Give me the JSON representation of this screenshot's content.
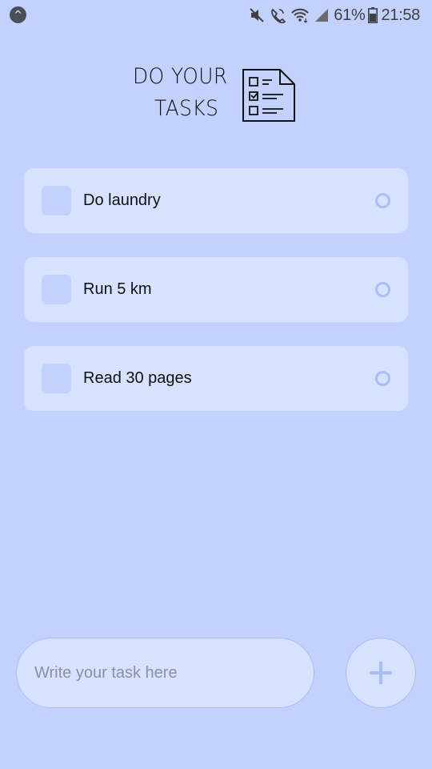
{
  "status_bar": {
    "app_badge_glyph": "^",
    "battery_percent": "61%",
    "time": "21:58",
    "icons": [
      "mute-icon",
      "call-icon",
      "wifi-icon",
      "signal-icon",
      "battery-icon"
    ]
  },
  "header": {
    "title_line1": "DO YOUR",
    "title_line2": "TASKS",
    "logo_icon": "checklist-icon"
  },
  "tasks": [
    {
      "label": "Do laundry",
      "done": false
    },
    {
      "label": "Run 5 km",
      "done": false
    },
    {
      "label": "Read 30 pages",
      "done": false
    }
  ],
  "composer": {
    "placeholder": "Write your task here",
    "value": "",
    "add_icon": "plus-icon"
  },
  "colors": {
    "background": "#c3d1ff",
    "card": "#d7e2ff",
    "accent": "#a9bdf6"
  }
}
